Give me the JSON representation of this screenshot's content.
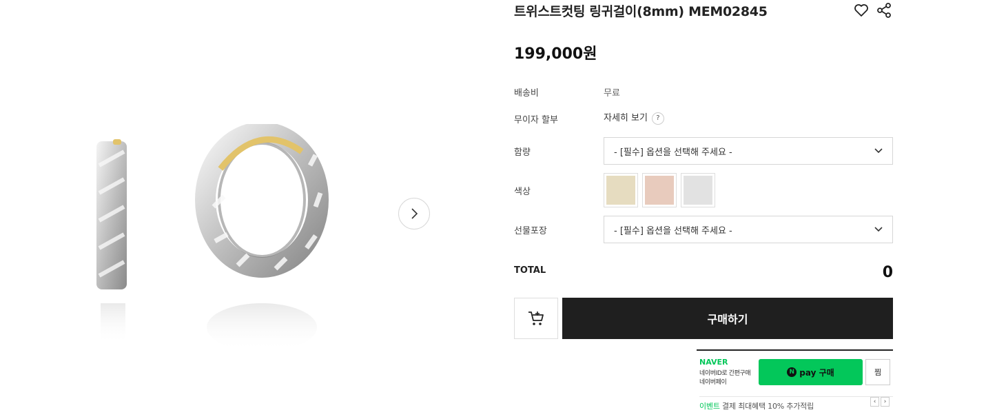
{
  "product": {
    "title": "트위스트컷팅 링귀걸이(8mm) MEM02845",
    "price": "199,000원"
  },
  "icons": {
    "wishlist": "heart-icon",
    "share": "share-icon",
    "next": "chevron-right-icon",
    "cart": "cart-icon",
    "dropdown": "chevron-down-icon"
  },
  "rows": {
    "shipping_label": "배송비",
    "shipping_value": "무료",
    "installment_label": "무이자 할부",
    "installment_value": "자세히 보기",
    "installment_help": "?",
    "purity_label": "함량",
    "purity_select": "- [필수] 옵션을 선택해 주세요 -",
    "color_label": "색상",
    "gift_label": "선물포장",
    "gift_select": "- [필수] 옵션을 선택해 주세요 -"
  },
  "swatches": [
    "#e6dcc0",
    "#e8cbbd",
    "#e2e2e2"
  ],
  "total": {
    "label": "TOTAL",
    "value": "0"
  },
  "buttons": {
    "buy": "구매하기"
  },
  "naver": {
    "brand": "NAVER",
    "sub1": "네이버ID로 간편구매",
    "sub2": "네이버페이",
    "pay_n": "N",
    "pay_label": "pay 구매",
    "jjim": "찜",
    "event_tag": "이벤트",
    "event_text": " 결제 최대혜택 10% 추가적립",
    "prev": "‹",
    "next": "›"
  },
  "colors": {
    "naver_green": "#03c75a",
    "buy_bg": "#1f1f1f"
  }
}
